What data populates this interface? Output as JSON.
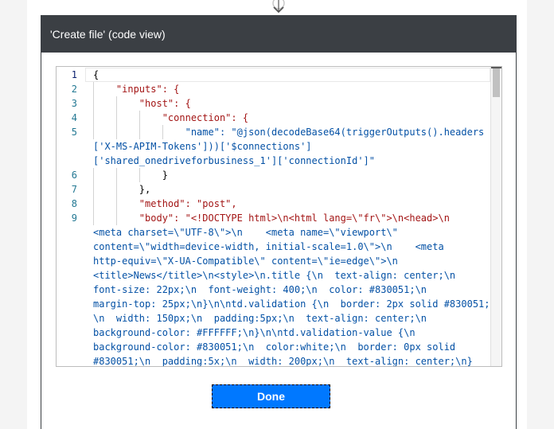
{
  "dialog": {
    "title": "'Create file' (code view)",
    "done_label": "Done"
  },
  "editor": {
    "line_numbers": [
      "1",
      "2",
      "3",
      "4",
      "5",
      "6",
      "7",
      "8",
      "9"
    ],
    "lines": [
      {
        "num": "1",
        "text": "{"
      },
      {
        "num": "2",
        "text": "    \"inputs\": {"
      },
      {
        "num": "3",
        "text": "        \"host\": {"
      },
      {
        "num": "4",
        "text": "            \"connection\": {"
      },
      {
        "num": "5",
        "text": "                \"name\": \"@json(decodeBase64(triggerOutputs().headers"
      },
      {
        "num": "",
        "text": "['X-MS-APIM-Tokens']))['$connections']"
      },
      {
        "num": "",
        "text": "['shared_onedriveforbusiness_1']['connectionId']\""
      },
      {
        "num": "6",
        "text": "            }"
      },
      {
        "num": "7",
        "text": "        },"
      },
      {
        "num": "8",
        "text": "        \"method\": \"post\","
      },
      {
        "num": "9",
        "text": "        \"body\": \"<!DOCTYPE html>\\n<html lang=\\\"fr\\\">\\n<head>\\n"
      },
      {
        "num": "",
        "text": "<meta charset=\\\"UTF-8\\\">\\n    <meta name=\\\"viewport\\\""
      },
      {
        "num": "",
        "text": "content=\\\"width=device-width, initial-scale=1.0\\\">\\n    <meta"
      },
      {
        "num": "",
        "text": "http-equiv=\\\"X-UA-Compatible\\\" content=\\\"ie=edge\\\">\\n"
      },
      {
        "num": "",
        "text": "<title>News</title>\\n<style>\\n.title {\\n  text-align: center;\\n"
      },
      {
        "num": "",
        "text": "font-size: 22px;\\n  font-weight: 400;\\n  color: #830051;\\n"
      },
      {
        "num": "",
        "text": "margin-top: 25px;\\n}\\n\\ntd.validation {\\n  border: 2px solid #830051;"
      },
      {
        "num": "",
        "text": "\\n  width: 150px;\\n  padding:5px;\\n  text-align: center;\\n"
      },
      {
        "num": "",
        "text": "background-color: #FFFFFF;\\n}\\n\\ntd.validation-value {\\n"
      },
      {
        "num": "",
        "text": "background-color: #830051;\\n  color:white;\\n  border: 0px solid"
      },
      {
        "num": "",
        "text": "#830051;\\n  padding:5x;\\n  width: 200px;\\n  text-align: center;\\n}"
      }
    ]
  }
}
